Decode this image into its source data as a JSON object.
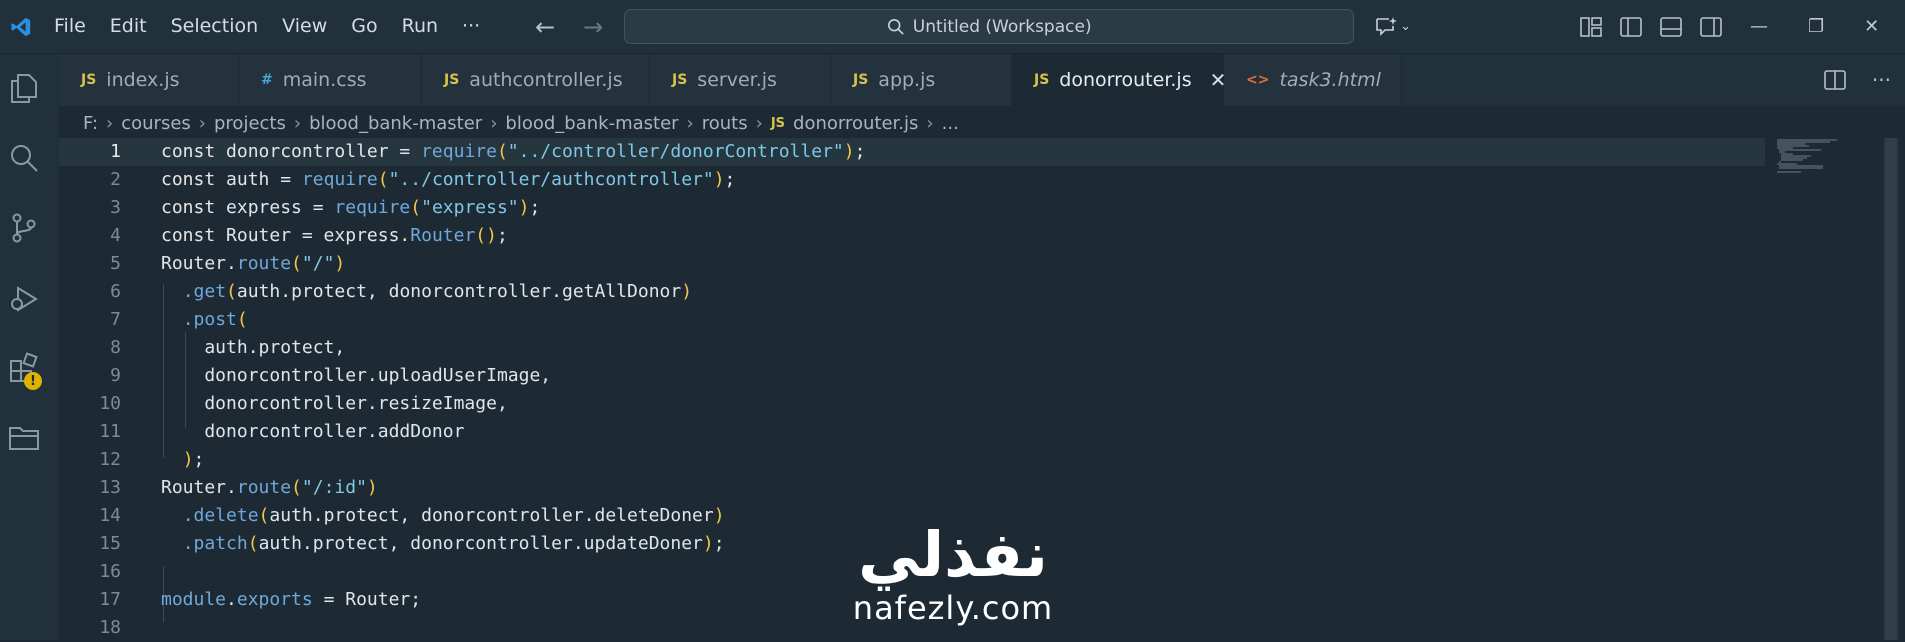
{
  "menu": [
    "File",
    "Edit",
    "Selection",
    "View",
    "Go",
    "Run",
    "···"
  ],
  "search": {
    "label": "Untitled (Workspace)"
  },
  "tabs": [
    {
      "icon": "JS",
      "label": "index.js"
    },
    {
      "icon": "#",
      "label": "main.css"
    },
    {
      "icon": "JS",
      "label": "authcontroller.js"
    },
    {
      "icon": "JS",
      "label": "server.js"
    },
    {
      "icon": "JS",
      "label": "app.js"
    },
    {
      "icon": "JS",
      "label": "donorrouter.js",
      "close": "✕"
    },
    {
      "icon": "<>",
      "label": "task3.html"
    }
  ],
  "breadcrumb": {
    "parts": [
      "F:",
      "courses",
      "projects",
      "blood_bank-master",
      "blood_bank-master",
      "routs"
    ],
    "file_icon": "JS",
    "file": "donorrouter.js",
    "tail": "..."
  },
  "activity_badge": "!",
  "code": {
    "line_numbers": [
      "1",
      "2",
      "3",
      "4",
      "5",
      "6",
      "7",
      "8",
      "9",
      "10",
      "11",
      "12",
      "13",
      "14",
      "15",
      "16",
      "17",
      "18"
    ],
    "current_line": 1
  },
  "watermark": {
    "arabic": "نفذلي",
    "latin": "nafezly.com"
  },
  "colors": {
    "background": "#1e2a33",
    "titlebar": "#21313b",
    "string": "#7fc7e8",
    "function": "#6fa8dc",
    "bracket": "#f0c84a",
    "js_icon": "#d8c34a"
  }
}
